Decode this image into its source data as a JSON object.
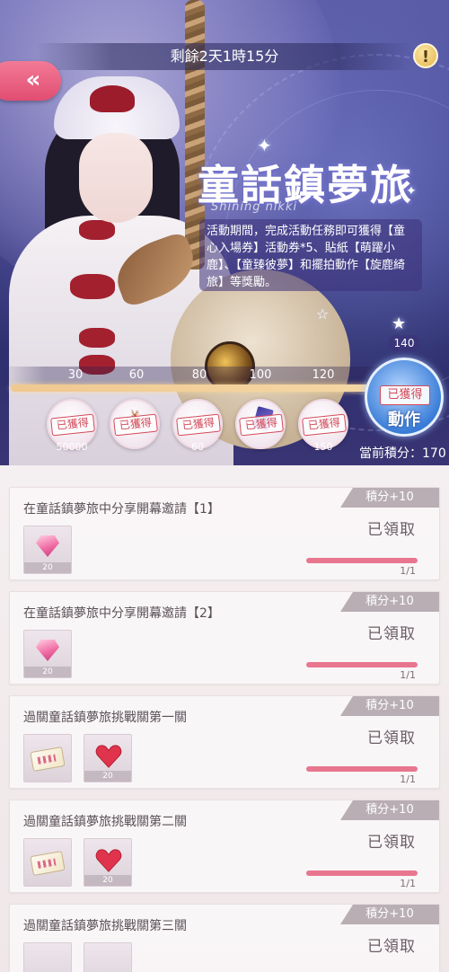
{
  "header": {
    "timer": "剩餘2天1時15分",
    "back_icon": "«",
    "info_icon": "!"
  },
  "event": {
    "title": "童話鎮夢旅",
    "subtitle": "Shining nikki",
    "description": "活動期間，完成活動任務即可獲得【童心入場券】活動券*5、貼紙【萌躍小鹿】、【童臻彼夢】和擺拍動作【旋鹿綺旅】等獎勵。"
  },
  "milestones": {
    "labels": [
      "30",
      "60",
      "80",
      "100",
      "120",
      "140"
    ],
    "rewards": [
      {
        "stamp": "已獲得",
        "qty": "50000",
        "icon": "coin-icon"
      },
      {
        "stamp": "已獲得",
        "qty": "",
        "icon": "deer-sticker-icon"
      },
      {
        "stamp": "已獲得",
        "qty": "60",
        "icon": "heart-item-icon"
      },
      {
        "stamp": "已獲得",
        "qty": "",
        "icon": "card-icon"
      },
      {
        "stamp": "已獲得",
        "qty": "150",
        "icon": "gem-item-icon"
      }
    ],
    "final": {
      "stamp": "已獲得",
      "label": "動作"
    }
  },
  "score": {
    "text": "當前積分：170",
    "value": 170
  },
  "tasks": [
    {
      "title": "在童話鎮夢旅中分享開幕邀請【1】",
      "points": "積分+10",
      "items": [
        {
          "type": "gem",
          "qty": "20"
        }
      ],
      "status": "已領取",
      "progress": "1/1"
    },
    {
      "title": "在童話鎮夢旅中分享開幕邀請【2】",
      "points": "積分+10",
      "items": [
        {
          "type": "gem",
          "qty": "20"
        }
      ],
      "status": "已領取",
      "progress": "1/1"
    },
    {
      "title": "過關童話鎮夢旅挑戰關第一關",
      "points": "積分+10",
      "items": [
        {
          "type": "ticket",
          "qty": ""
        },
        {
          "type": "heart",
          "qty": "20"
        }
      ],
      "status": "已領取",
      "progress": "1/1"
    },
    {
      "title": "過關童話鎮夢旅挑戰關第二關",
      "points": "積分+10",
      "items": [
        {
          "type": "ticket",
          "qty": ""
        },
        {
          "type": "heart",
          "qty": "20"
        }
      ],
      "status": "已領取",
      "progress": "1/1"
    },
    {
      "title": "過關童話鎮夢旅挑戰關第三關",
      "points": "積分+10",
      "items": [
        {
          "type": "ticket",
          "qty": ""
        },
        {
          "type": "heart",
          "qty": ""
        }
      ],
      "status": "已領取",
      "progress": ""
    }
  ],
  "colors": {
    "accent_pink": "#e24d72",
    "progress_pink": "#e8768f",
    "stamp_red": "#d24a5a",
    "banner_blue": "#3d3f88"
  }
}
